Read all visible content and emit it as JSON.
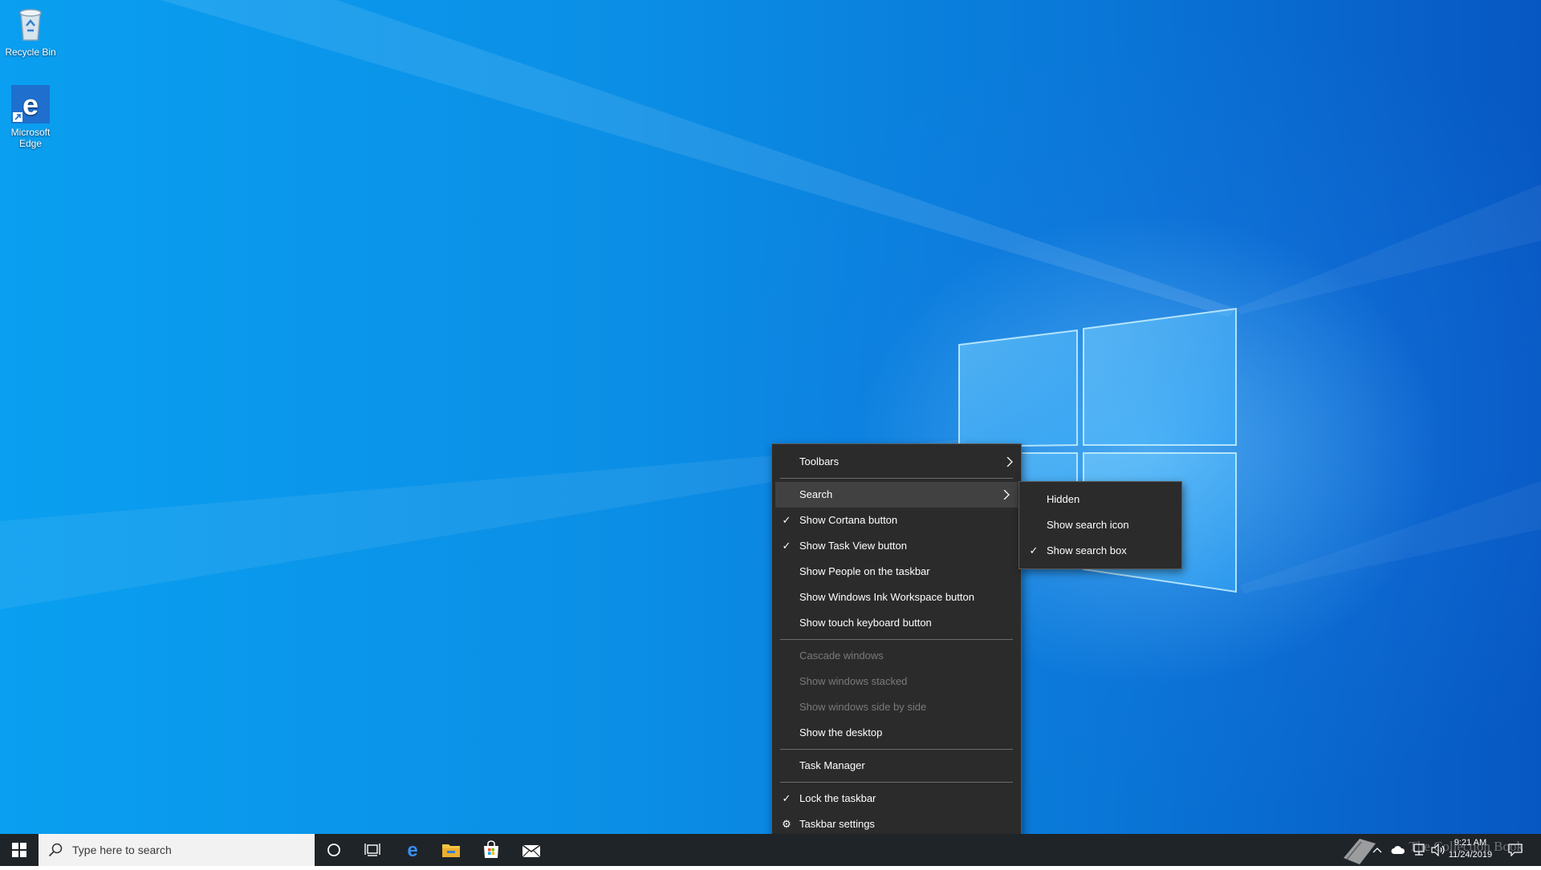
{
  "desktop": {
    "icons": [
      {
        "label": "Recycle Bin",
        "icon": "recycle-bin-icon"
      },
      {
        "label_line1": "Microsoft",
        "label_line2": "Edge",
        "icon": "edge-icon"
      }
    ]
  },
  "context_menu": {
    "items": [
      {
        "label": "Toolbars",
        "checked": false,
        "submenu": true
      },
      {
        "label": "Search",
        "checked": false,
        "submenu": true,
        "highlighted": true
      },
      {
        "label": "Show Cortana button",
        "checked": true
      },
      {
        "label": "Show Task View button",
        "checked": true
      },
      {
        "label": "Show People on the taskbar",
        "checked": false
      },
      {
        "label": "Show Windows Ink Workspace button",
        "checked": false
      },
      {
        "label": "Show touch keyboard button",
        "checked": false
      },
      {
        "label": "Cascade windows",
        "disabled": true
      },
      {
        "label": "Show windows stacked",
        "disabled": true
      },
      {
        "label": "Show windows side by side",
        "disabled": true
      },
      {
        "label": "Show the desktop"
      },
      {
        "label": "Task Manager"
      },
      {
        "label": "Lock the taskbar",
        "checked": true
      },
      {
        "label": "Taskbar settings",
        "icon": "gear-icon"
      }
    ]
  },
  "search_submenu": {
    "items": [
      {
        "label": "Hidden",
        "checked": false
      },
      {
        "label": "Show search icon",
        "checked": false
      },
      {
        "label": "Show search box",
        "checked": true
      }
    ]
  },
  "taskbar": {
    "search_placeholder": "Type here to search",
    "pinned": [
      "cortana-icon",
      "task-view-icon",
      "edge-icon",
      "file-explorer-icon",
      "store-icon",
      "mail-icon"
    ],
    "clock_time": "9:21 AM",
    "clock_date": "11/24/2019",
    "watermark": "The Collection Book"
  },
  "colors": {
    "taskbar_bg": "#1f2429",
    "menu_bg": "#2b2b2b",
    "menu_highlight": "#414141",
    "desktop_blue": "#0a8fe6"
  }
}
